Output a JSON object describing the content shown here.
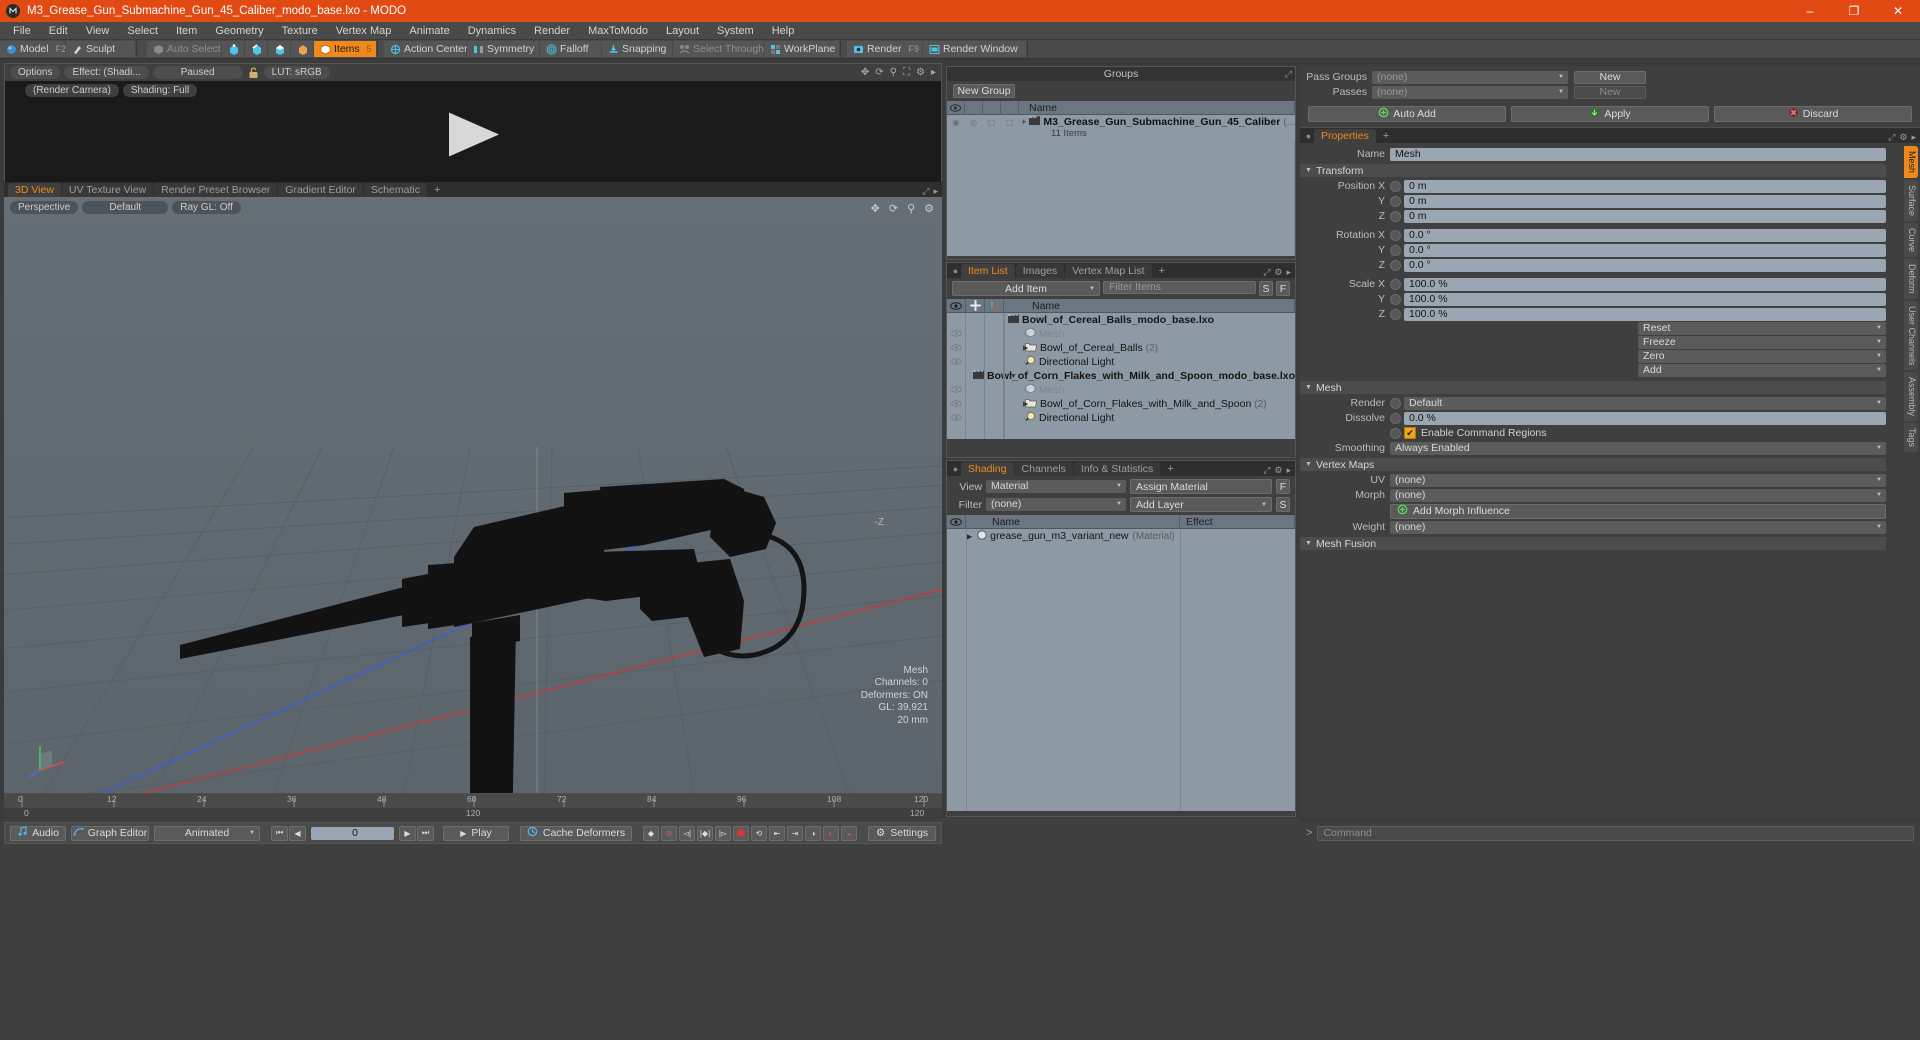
{
  "window": {
    "title": "M3_Grease_Gun_Submachine_Gun_45_Caliber_modo_base.lxo - MODO",
    "minimize": "–",
    "maximize": "❐",
    "close": "✕"
  },
  "menu": [
    "File",
    "Edit",
    "View",
    "Select",
    "Item",
    "Geometry",
    "Texture",
    "Vertex Map",
    "Animate",
    "Dynamics",
    "Render",
    "MaxToModo",
    "Layout",
    "System",
    "Help"
  ],
  "toolbar": {
    "mode": [
      {
        "label": "Model",
        "shortcut": "F2",
        "icon": "sphere-icon",
        "state": "normal"
      },
      {
        "label": "Sculpt",
        "shortcut": "",
        "icon": "brush-icon",
        "state": "normal"
      }
    ],
    "selection": [
      {
        "label": "Auto Select",
        "shortcut": "",
        "icon": "cube-icon",
        "state": "dim"
      },
      {
        "label": "",
        "shortcut": "",
        "icon": "vertices-icon",
        "state": "normal"
      },
      {
        "label": "",
        "shortcut": "",
        "icon": "edges-icon",
        "state": "normal"
      },
      {
        "label": "",
        "shortcut": "",
        "icon": "polygons-icon",
        "state": "normal"
      },
      {
        "label": "",
        "shortcut": "",
        "icon": "materials-icon",
        "state": "normal"
      },
      {
        "label": "Items",
        "shortcut": "5",
        "icon": "items-icon",
        "state": "active"
      }
    ],
    "tools": [
      {
        "label": "Action Center",
        "shortcut": "",
        "icon": "action-center-icon",
        "state": "normal"
      },
      {
        "label": "Symmetry",
        "shortcut": "",
        "icon": "symmetry-icon",
        "state": "normal"
      },
      {
        "label": "Falloff",
        "shortcut": "",
        "icon": "falloff-icon",
        "state": "normal"
      },
      {
        "label": "Snapping",
        "shortcut": "",
        "icon": "snapping-icon",
        "state": "normal"
      },
      {
        "label": "Select Through",
        "shortcut": "",
        "icon": "select-through-icon",
        "state": "dim"
      },
      {
        "label": "WorkPlane",
        "shortcut": "",
        "icon": "workplane-icon",
        "state": "normal"
      }
    ],
    "render": [
      {
        "label": "Render",
        "shortcut": "F9",
        "icon": "render-icon",
        "state": "normal"
      },
      {
        "label": "Render Window",
        "shortcut": "",
        "icon": "render-window-icon",
        "state": "normal"
      }
    ]
  },
  "preview": {
    "buttons": [
      "Options",
      "Effect: (Shadi...",
      "Paused"
    ],
    "lock_icon": "unlock-icon",
    "lut": "LUT: sRGB",
    "camera": "(Render Camera)",
    "shading": "Shading: Full",
    "icons": [
      "move-icon",
      "refresh-icon",
      "zoom-icon",
      "fit-icon",
      "gear-icon",
      "chevron-right-icon"
    ],
    "play_overlay": "play-triangle-icon"
  },
  "viewport": {
    "tabs": [
      {
        "label": "3D View",
        "active": true
      },
      {
        "label": "UV Texture View",
        "active": false
      },
      {
        "label": "Render Preset Browser",
        "active": false
      },
      {
        "label": "Gradient Editor",
        "active": false
      },
      {
        "label": "Schematic",
        "active": false
      }
    ],
    "plus": "+",
    "chips": [
      "Perspective",
      "Default",
      "Ray GL: Off"
    ],
    "icons": [
      "move-icon",
      "rotate-icon",
      "zoom-icon",
      "gear-icon"
    ],
    "stats": {
      "title": "Mesh",
      "lines": [
        "Channels: 0",
        "Deformers: ON",
        "GL: 39,921",
        "20 mm"
      ]
    },
    "axis_label_z": "-Z",
    "gizmo": "axis-gizmo-icon"
  },
  "ruler": {
    "ticks": [
      "0",
      "12",
      "24",
      "36",
      "48",
      "60",
      "72",
      "84",
      "96",
      "108",
      "120"
    ],
    "center_label": "120",
    "right_label": "120",
    "left_label": "0"
  },
  "groups_panel": {
    "title": "Groups",
    "new_group_button": "New Group",
    "column_header": "Name",
    "row": {
      "name": "M3_Grease_Gun_Submachine_Gun_45_Caliber",
      "suffix": "(...",
      "subtitle": "11 Items",
      "icon": "group-icon"
    }
  },
  "item_list": {
    "tabs": [
      {
        "label": "Item List",
        "active": true
      },
      {
        "label": "Images",
        "active": false
      },
      {
        "label": "Vertex Map List",
        "active": false
      }
    ],
    "plus": "+",
    "add_item_button": "Add Item",
    "filter_placeholder": "Filter Items",
    "filter_s": "S",
    "filter_f": "F",
    "columns": [
      "eye-icon",
      "add-icon",
      "axis-icon",
      "Name"
    ],
    "rows": [
      {
        "name": "Bowl_of_Cereal_Balls_modo_base.lxo",
        "icon": "scene-icon",
        "indent": 0,
        "expanded": true,
        "dim": false,
        "count": "",
        "eye": false
      },
      {
        "name": "Mesh",
        "icon": "mesh-icon",
        "indent": 1,
        "expanded": false,
        "dim": true,
        "count": "",
        "eye": true
      },
      {
        "name": "Bowl_of_Cereal_Balls",
        "icon": "folder-icon",
        "indent": 1,
        "expanded": false,
        "arrow": true,
        "dim": false,
        "count": "(2)",
        "eye": true
      },
      {
        "name": "Directional Light",
        "icon": "light-icon",
        "indent": 1,
        "expanded": false,
        "dim": false,
        "count": "",
        "eye": true
      },
      {
        "name": "Bowl_of_Corn_Flakes_with_Milk_and_Spoon_modo_base.lxo",
        "icon": "scene-icon",
        "indent": 0,
        "expanded": true,
        "dim": false,
        "count": "",
        "eye": false
      },
      {
        "name": "Mesh",
        "icon": "mesh-icon",
        "indent": 1,
        "expanded": false,
        "dim": true,
        "count": "",
        "eye": true
      },
      {
        "name": "Bowl_of_Corn_Flakes_with_Milk_and_Spoon",
        "icon": "folder-icon",
        "indent": 1,
        "expanded": false,
        "arrow": true,
        "dim": false,
        "count": "(2)",
        "eye": true
      },
      {
        "name": "Directional Light",
        "icon": "light-icon",
        "indent": 1,
        "expanded": false,
        "dim": false,
        "count": "",
        "eye": true
      }
    ]
  },
  "shading_panel": {
    "tabs": [
      {
        "label": "Shading",
        "active": true
      },
      {
        "label": "Channels",
        "active": false
      },
      {
        "label": "Info & Statistics",
        "active": false
      }
    ],
    "plus": "+",
    "view_label": "View",
    "view_value": "Material",
    "assign_material_button": "Assign Material",
    "assign_f": "F",
    "filter_label": "Filter",
    "filter_value": "(none)",
    "add_layer_button": "Add Layer",
    "add_layer_s": "S",
    "columns": [
      "Name",
      "Effect"
    ],
    "rows": [
      {
        "name": "grease_gun_m3_variant_new",
        "type": "(Material)",
        "effect": "",
        "icon": "material-icon"
      }
    ]
  },
  "properties": {
    "pass_groups_label": "Pass Groups",
    "pass_groups_value": "(none)",
    "passes_label": "Passes",
    "passes_value": "(none)",
    "new_button_1": "New",
    "new_button_2": "New",
    "auto_add_button": "Auto Add",
    "apply_button": "Apply",
    "discard_button": "Discard",
    "tabs": [
      {
        "label": "Properties",
        "active": true
      }
    ],
    "plus": "+",
    "name_label": "Name",
    "name_value": "Mesh",
    "transform": {
      "title": "Transform",
      "fields": [
        {
          "label": "Position X",
          "value": "0 m"
        },
        {
          "label": "Y",
          "value": "0 m"
        },
        {
          "label": "Z",
          "value": "0 m"
        },
        {
          "label": "Rotation X",
          "value": "0.0 °"
        },
        {
          "label": "Y",
          "value": "0.0 °"
        },
        {
          "label": "Z",
          "value": "0.0 °"
        },
        {
          "label": "Scale X",
          "value": "100.0 %"
        },
        {
          "label": "Y",
          "value": "100.0 %"
        },
        {
          "label": "Z",
          "value": "100.0 %"
        }
      ],
      "actions": [
        "Reset",
        "Freeze",
        "Zero",
        "Add"
      ]
    },
    "mesh": {
      "title": "Mesh",
      "render_label": "Render",
      "render_value": "Default",
      "dissolve_label": "Dissolve",
      "dissolve_value": "0.0 %",
      "enable_command_regions": "Enable Command Regions",
      "enable_checked": true,
      "smoothing_label": "Smoothing",
      "smoothing_value": "Always Enabled"
    },
    "vertex_maps": {
      "title": "Vertex Maps",
      "uv_label": "UV",
      "uv_value": "(none)",
      "morph_label": "Morph",
      "morph_value": "(none)",
      "add_morph_button": "Add Morph Influence",
      "weight_label": "Weight",
      "weight_value": "(none)"
    },
    "mesh_fusion": {
      "title": "Mesh Fusion"
    }
  },
  "right_rail": [
    "Mesh",
    "Surface",
    "Curve",
    "Deform",
    "User Channels",
    "Assembly",
    "Tags"
  ],
  "bottom_bar": {
    "audio": "Audio",
    "graph_editor": "Graph Editor",
    "animated": "Animated",
    "frame_value": "0",
    "play": "Play",
    "cache_deformers": "Cache Deformers",
    "settings": "Settings",
    "command_placeholder": "Command",
    "command_prompt": ">",
    "transport_icons": [
      "skip-start-icon",
      "step-back-icon",
      "step-forward-icon",
      "skip-end-icon"
    ],
    "record_icons": [
      "key-icon",
      "no-key-icon",
      "prev-key-icon",
      "set-key-icon",
      "next-key-icon",
      "record-icon",
      "anim-icon",
      "range-start-icon",
      "range-end-icon",
      "ghost-left-icon",
      "ghost-mid-icon",
      "ghost-right-icon"
    ]
  },
  "colors": {
    "accent": "#f0891b",
    "title_bar": "#e24a14",
    "panel_bg": "#3f3f3f",
    "list_header": "#6a7682",
    "field_bg": "#9aa6b1",
    "viewport_bg": "#606a70"
  }
}
